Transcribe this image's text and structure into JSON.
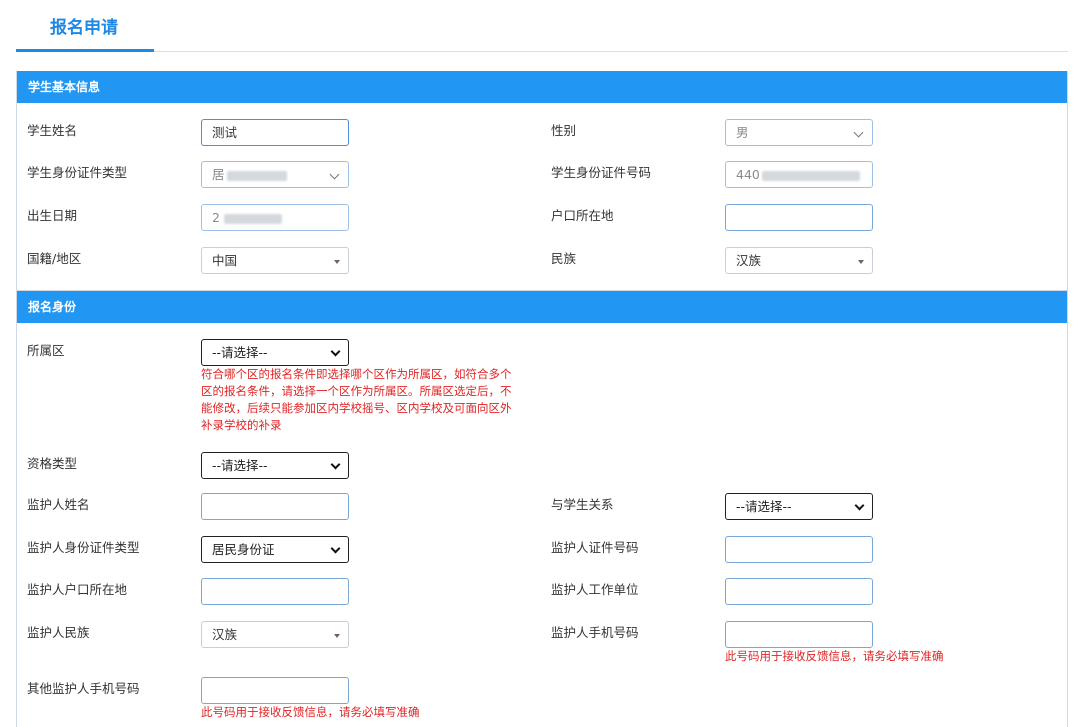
{
  "tab": {
    "label": "报名申请"
  },
  "section_student": {
    "title": "学生基本信息",
    "name_label": "学生姓名",
    "name_value": "测试",
    "gender_label": "性别",
    "gender_value": "男",
    "id_type_label": "学生身份证件类型",
    "id_type_value": "居",
    "id_no_label": "学生身份证件号码",
    "id_no_value": "440",
    "birth_label": "出生日期",
    "birth_value": "2",
    "hukou_label": "户口所在地",
    "hukou_value": "",
    "nationality_label": "国籍/地区",
    "nationality_value": "中国",
    "ethnicity_label": "民族",
    "ethnicity_value": "汉族"
  },
  "section_apply": {
    "title": "报名身份",
    "district_label": "所属区",
    "district_value": "--请选择--",
    "district_hint": [
      "符合哪个区的报名条件即选择哪个区作为所属区，如符合多个",
      "区的报名条件，请选择一个区作为所属区。所属区选定后，不",
      "能修改，后续只能参加区内学校摇号、区内学校及可面向区外",
      "补录学校的补录"
    ],
    "qualification_label": "资格类型",
    "qualification_value": "--请选择--",
    "guardian_name_label": "监护人姓名",
    "guardian_name_value": "",
    "relation_label": "与学生关系",
    "relation_value": "--请选择--",
    "guardian_id_type_label": "监护人身份证件类型",
    "guardian_id_type_value": "居民身份证",
    "guardian_id_no_label": "监护人证件号码",
    "guardian_id_no_value": "",
    "guardian_hukou_label": "监护人户口所在地",
    "guardian_hukou_value": "",
    "guardian_work_label": "监护人工作单位",
    "guardian_work_value": "",
    "guardian_ethnicity_label": "监护人民族",
    "guardian_ethnicity_value": "汉族",
    "guardian_phone_label": "监护人手机号码",
    "guardian_phone_value": "",
    "guardian_phone_hint": "此号码用于接收反馈信息，请务必填写准确",
    "other_phone_label": "其他监护人手机号码",
    "other_phone_value": "",
    "other_phone_hint": "此号码用于接收反馈信息，请务必填写准确"
  },
  "colors": {
    "accent": "#2196f3",
    "tab_text": "#1e88e5",
    "hint": "#e02424"
  }
}
